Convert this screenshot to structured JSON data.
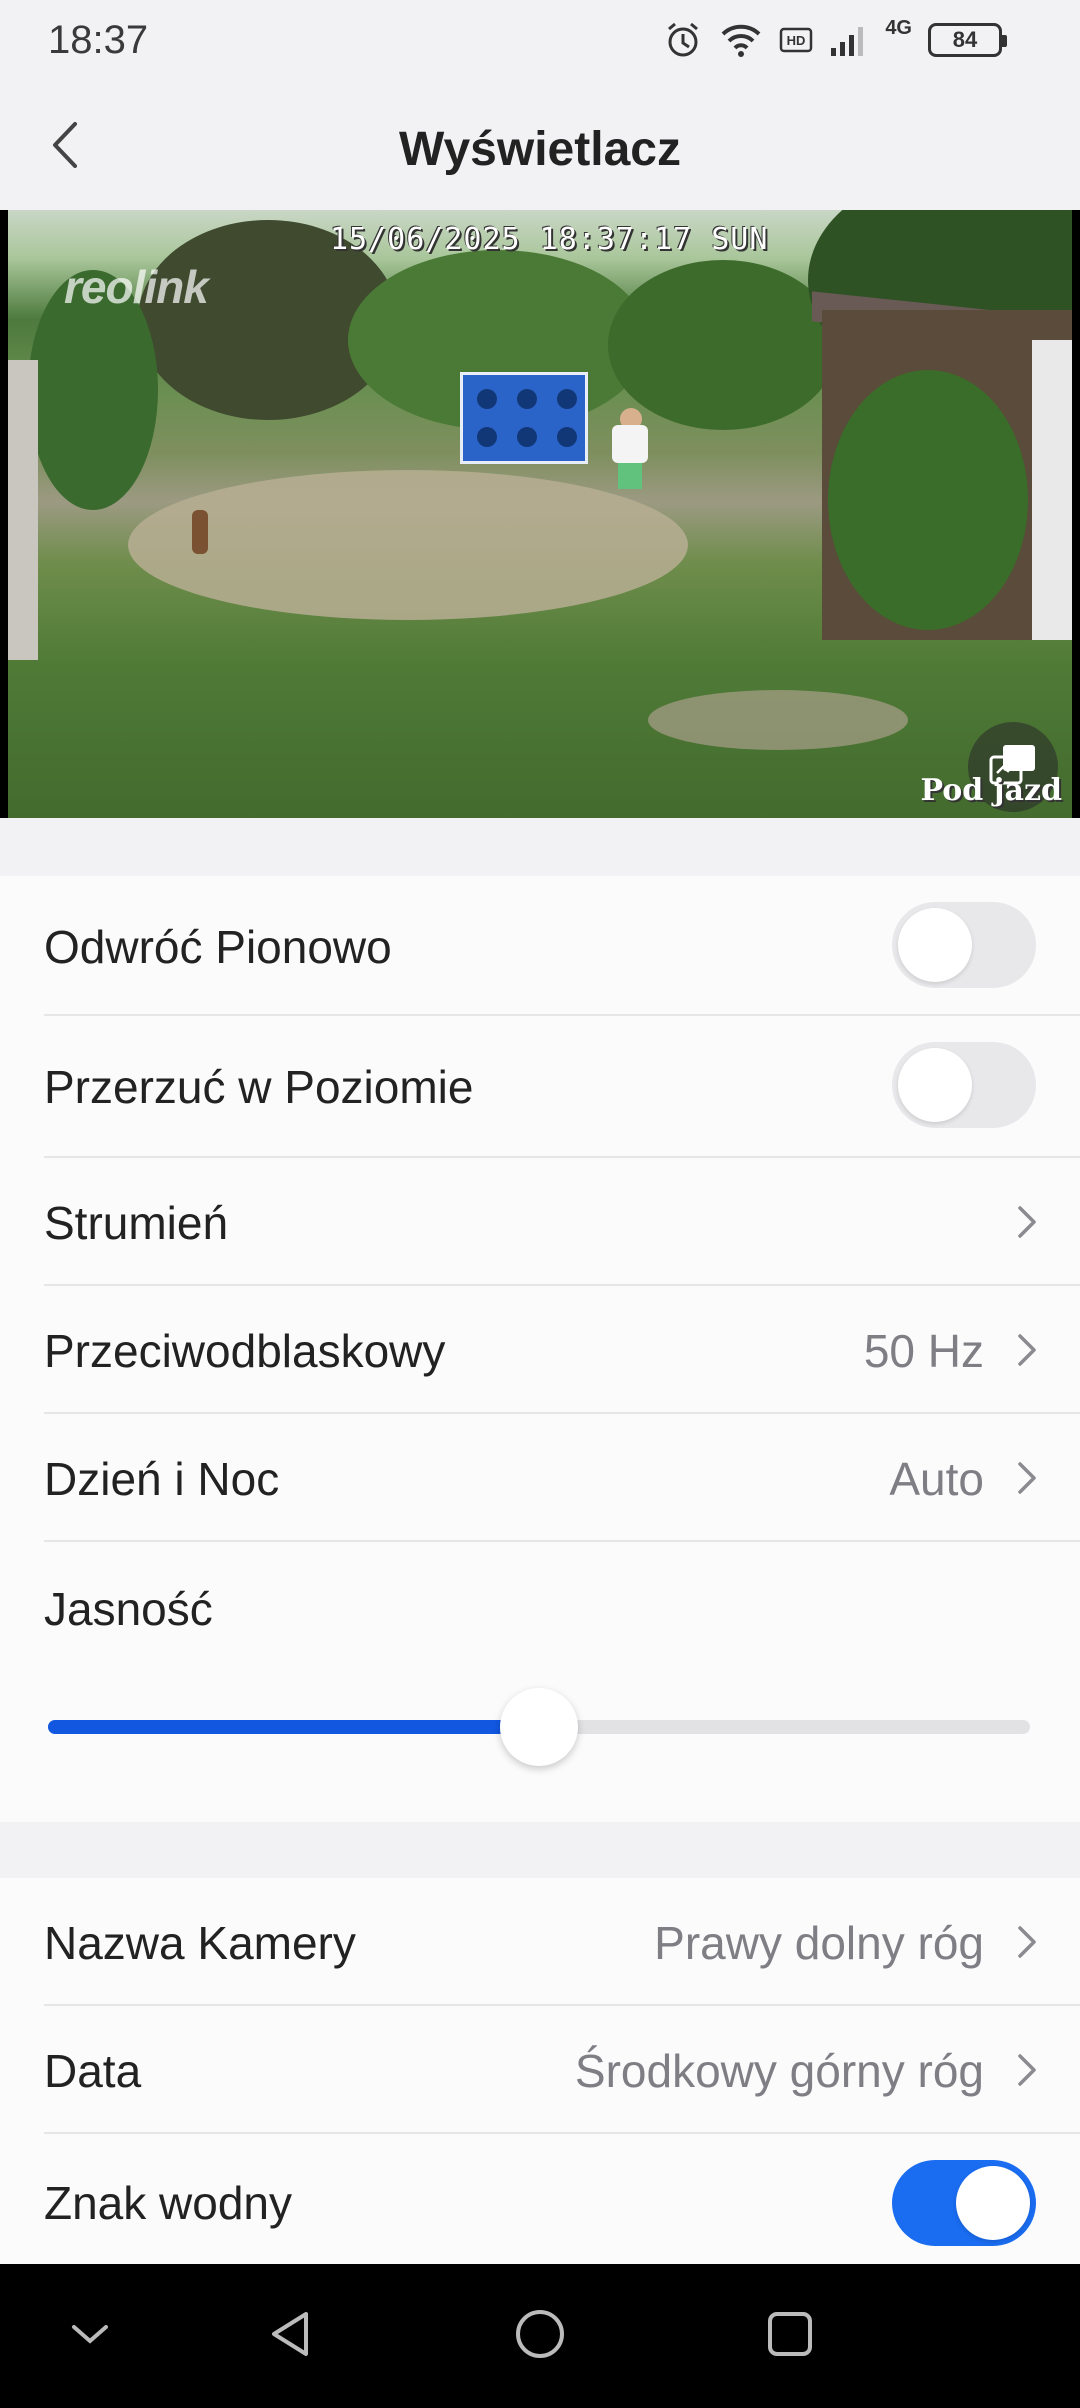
{
  "status_bar": {
    "time": "18:37",
    "network": "4G",
    "battery": "84",
    "icons": [
      "alarm-icon",
      "wifi-icon",
      "hd-icon",
      "signal-icon",
      "battery-icon"
    ]
  },
  "header": {
    "title": "Wyświetlacz",
    "back_icon": "chevron-left-icon"
  },
  "video": {
    "osd_datetime": "15/06/2025 18:37:17 SUN",
    "osd_logo": "reolink",
    "osd_camera_name": "Pod jazd",
    "pip_icon": "picture-in-picture-icon"
  },
  "settings": {
    "flip_vertical": {
      "label": "Odwróć Pionowo",
      "enabled": false
    },
    "flip_horizontal": {
      "label": "Przerzuć w Poziomie",
      "enabled": false
    },
    "stream": {
      "label": "Strumień"
    },
    "anti_flicker": {
      "label": "Przeciwodblaskowy",
      "value": "50 Hz"
    },
    "day_night": {
      "label": "Dzień i Noc",
      "value": "Auto"
    },
    "brightness": {
      "label": "Jasność",
      "value_fraction": 0.5
    }
  },
  "osd_settings": {
    "camera_name": {
      "label": "Nazwa Kamery",
      "value": "Prawy dolny róg"
    },
    "date": {
      "label": "Data",
      "value": "Środkowy górny róg"
    },
    "watermark": {
      "label": "Znak wodny",
      "enabled": true
    }
  },
  "colors": {
    "accent": "#1a6cf0",
    "slider_fill": "#1157e0",
    "background": "#f2f2f4",
    "card": "#fbfbfc"
  },
  "system_nav": {
    "icons": [
      "chevron-down-icon",
      "back-triangle-icon",
      "home-circle-icon",
      "recents-square-icon"
    ]
  }
}
